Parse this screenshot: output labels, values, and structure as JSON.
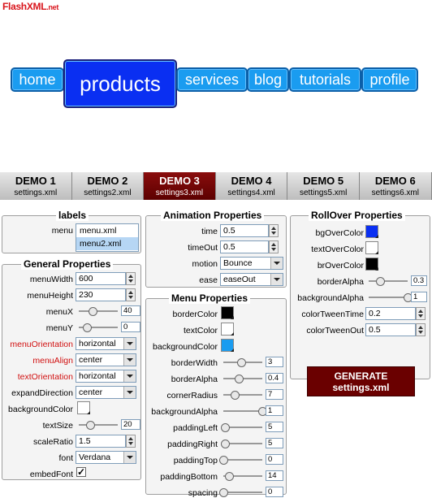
{
  "logo": {
    "main": "FlashXML",
    "suffix": ".net"
  },
  "nav": [
    {
      "label": "home",
      "active": false
    },
    {
      "label": "products",
      "active": true
    },
    {
      "label": "services",
      "active": false
    },
    {
      "label": "blog",
      "active": false
    },
    {
      "label": "tutorials",
      "active": false
    },
    {
      "label": "profile",
      "active": false
    }
  ],
  "tabs": [
    {
      "title": "DEMO 1",
      "file": "settings.xml",
      "active": false
    },
    {
      "title": "DEMO 2",
      "file": "settings2.xml",
      "active": false
    },
    {
      "title": "DEMO 3",
      "file": "settings3.xml",
      "active": true
    },
    {
      "title": "DEMO 4",
      "file": "settings4.xml",
      "active": false
    },
    {
      "title": "DEMO 5",
      "file": "settings5.xml",
      "active": false
    },
    {
      "title": "DEMO 6",
      "file": "settings6.xml",
      "active": false
    }
  ],
  "labels": {
    "title": "labels",
    "menu_label": "menu",
    "items": [
      "menu.xml",
      "menu2.xml"
    ],
    "selected_index": 1
  },
  "general": {
    "title": "General Properties",
    "menuWidth": {
      "label": "menuWidth",
      "value": "600"
    },
    "menuHeight": {
      "label": "menuHeight",
      "value": "230"
    },
    "menuX": {
      "label": "menuX",
      "value": "40",
      "level": 0.35
    },
    "menuY": {
      "label": "menuY",
      "value": "0",
      "level": 0.2
    },
    "menuOrientation": {
      "label": "menuOrientation",
      "value": "horizontal"
    },
    "menuAlign": {
      "label": "menuAlign",
      "value": "center"
    },
    "textOrientation": {
      "label": "textOrientation",
      "value": "horizontal"
    },
    "expandDirection": {
      "label": "expandDirection",
      "value": "center"
    },
    "backgroundColor": {
      "label": "backgroundColor",
      "color": "#ffffff"
    },
    "textSize": {
      "label": "textSize",
      "value": "20",
      "level": 0.3
    },
    "scaleRatio": {
      "label": "scaleRatio",
      "value": "1.5"
    },
    "font": {
      "label": "font",
      "value": "Verdana"
    },
    "embedFont": {
      "label": "embedFont",
      "mark": "✓"
    }
  },
  "animation": {
    "title": "Animation Properties",
    "time": {
      "label": "time",
      "value": "0.5"
    },
    "timeOut": {
      "label": "timeOut",
      "value": "0.5"
    },
    "motion": {
      "label": "motion",
      "value": "Bounce"
    },
    "ease": {
      "label": "ease",
      "value": "easeOut"
    }
  },
  "menuprops": {
    "title": "Menu Properties",
    "borderColor": {
      "label": "borderColor",
      "color": "#000000"
    },
    "textColor": {
      "label": "textColor",
      "color": "#ffffff"
    },
    "backgroundColor": {
      "label": "backgroundColor",
      "color": "#1a9cf0"
    },
    "sliders": [
      {
        "label": "borderWidth",
        "value": "3",
        "level": 0.45
      },
      {
        "label": "borderAlpha",
        "value": "0.4",
        "level": 0.4
      },
      {
        "label": "cornerRadius",
        "value": "7",
        "level": 0.3
      },
      {
        "label": "backgroundAlpha",
        "value": "1",
        "level": 1.0
      },
      {
        "label": "paddingLeft",
        "value": "5",
        "level": 0.05
      },
      {
        "label": "paddingRight",
        "value": "5",
        "level": 0.05
      },
      {
        "label": "paddingTop",
        "value": "0",
        "level": 0.0
      },
      {
        "label": "paddingBottom",
        "value": "14",
        "level": 0.15
      },
      {
        "label": "spacing",
        "value": "0",
        "level": 0.0
      }
    ]
  },
  "rollover": {
    "title": "RollOver Properties",
    "bgOverColor": {
      "label": "bgOverColor",
      "color": "#0a2ff2"
    },
    "textOverColor": {
      "label": "textOverColor",
      "color": "#ffffff"
    },
    "brOverColor": {
      "label": "brOverColor",
      "color": "#000000"
    },
    "borderAlpha": {
      "label": "borderAlpha",
      "value": "0.3",
      "level": 0.3
    },
    "backgroundAlpha": {
      "label": "backgroundAlpha",
      "value": "1",
      "level": 1.0
    },
    "colorTweenTime": {
      "label": "colorTweenTime",
      "value": "0.2"
    },
    "colorTweenOut": {
      "label": "colorTweenOut",
      "value": "0.5"
    }
  },
  "generate": {
    "line1": "GENERATE",
    "line2": "settings.xml"
  }
}
